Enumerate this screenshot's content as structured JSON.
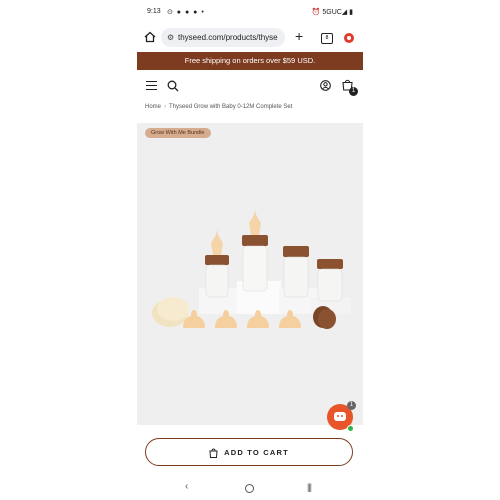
{
  "status": {
    "time": "9:13",
    "app_icons": "⊙ ● ● ● •",
    "right": "⏰ 5GUC◢ ▮"
  },
  "browser": {
    "url": "thyseed.com/products/thyse",
    "tab_count": "8"
  },
  "promo": {
    "text": "Free shipping on orders over $59 USD."
  },
  "header": {
    "cart_count": "1"
  },
  "breadcrumb": {
    "home": "Home",
    "current": "Thyseed Grow with Baby 0-12M Complete Set"
  },
  "product": {
    "tag": "Grow With Me Bundle"
  },
  "chat": {
    "unread": "1"
  },
  "cta": {
    "label": "ADD TO CART"
  },
  "colors": {
    "brand": "#7d3c1f",
    "tag_bg": "#d5ad8e",
    "chat": "#e8552b"
  }
}
